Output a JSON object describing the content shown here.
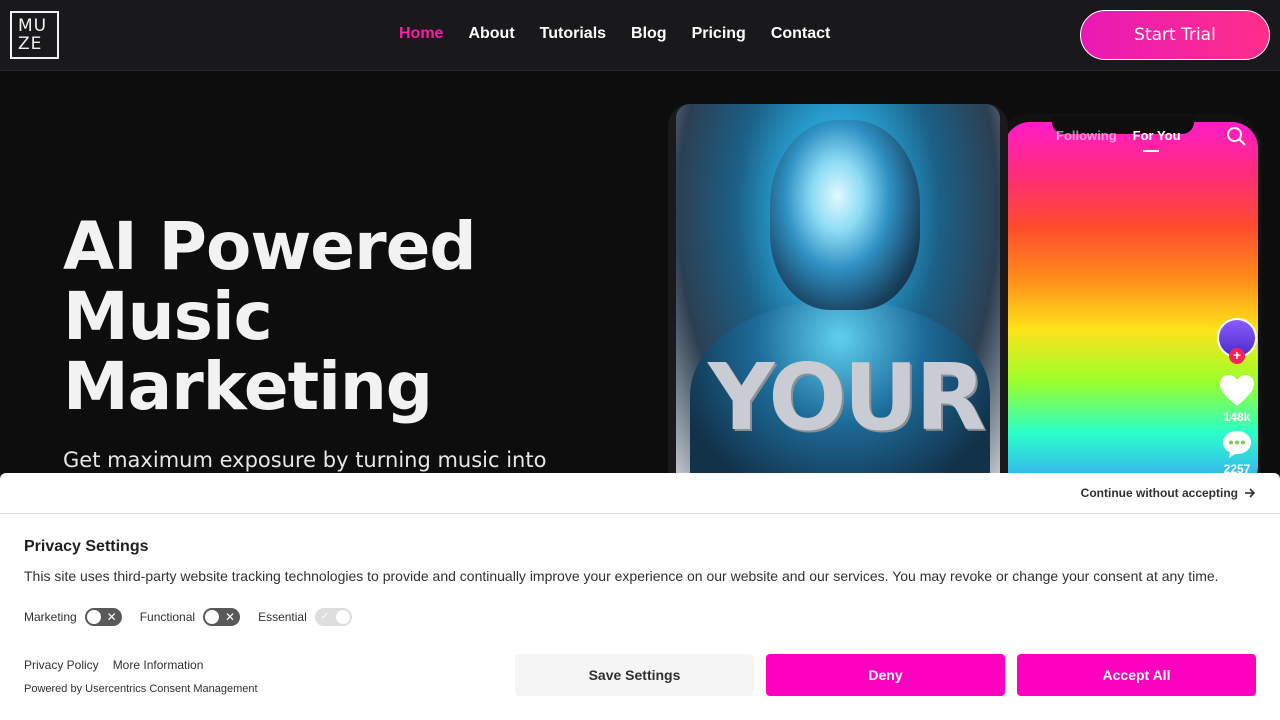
{
  "header": {
    "logo_line1": "MU",
    "logo_line2": "ZE",
    "nav": [
      {
        "label": "Home",
        "active": true
      },
      {
        "label": "About"
      },
      {
        "label": "Tutorials"
      },
      {
        "label": "Blog"
      },
      {
        "label": "Pricing"
      },
      {
        "label": "Contact"
      }
    ],
    "cta": "Start Trial"
  },
  "hero": {
    "title_line1": "AI Powered",
    "title_line2": "Music",
    "title_line3": "Marketing",
    "subtitle": "Get maximum exposure by turning music into"
  },
  "phone": {
    "tab_following": "Following",
    "tab_foryou": "For You",
    "overlay_text": "YOUR",
    "likes": "148k",
    "comments": "2257"
  },
  "consent": {
    "continue": "Continue without accepting",
    "title": "Privacy Settings",
    "text": "This site uses third-party website tracking technologies to provide and continually improve your experience on our website and our services. You may revoke or change your consent at any time.",
    "toggles": [
      {
        "label": "Marketing",
        "enabled": false
      },
      {
        "label": "Functional",
        "enabled": false
      },
      {
        "label": "Essential",
        "enabled": true
      }
    ],
    "link_privacy": "Privacy Policy",
    "link_more": "More Information",
    "powered": "Powered by Usercentrics Consent Management",
    "btn_save": "Save Settings",
    "btn_deny": "Deny",
    "btn_accept": "Accept All"
  },
  "colors": {
    "accent": "#ff1aa8",
    "button_pink": "#ff00c0",
    "header_bg": "#19191b",
    "page_bg": "#0d0d0e"
  }
}
